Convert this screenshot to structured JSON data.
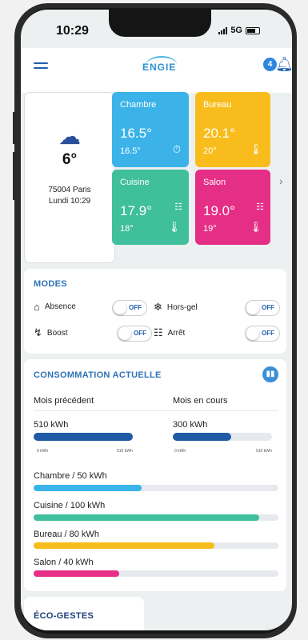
{
  "status_bar": {
    "time": "10:29",
    "network": "5G"
  },
  "header": {
    "logo": "ENGIE",
    "notification_count": "4"
  },
  "weather": {
    "temperature": "6°",
    "location": "75004 Paris",
    "datetime": "Lundi 10:29"
  },
  "rooms": [
    {
      "name": "Chambre",
      "current": "16.5°",
      "setpoint": "16.5°",
      "color": "#3bb3e8",
      "icon": "timer-icon"
    },
    {
      "name": "Bureau",
      "current": "20.1°",
      "setpoint": "20°",
      "color": "#f8bd1c",
      "icon": "thermometer-icon"
    },
    {
      "name": "Cuisine",
      "current": "17.9°",
      "setpoint": "18°",
      "color": "#3fbf9c",
      "icon": "thermometer-icon"
    },
    {
      "name": "Salon",
      "current": "19.0°",
      "setpoint": "19°",
      "color": "#e52e86",
      "icon": "thermometer-icon"
    }
  ],
  "modes": {
    "title": "MODES",
    "items": [
      {
        "label": "Absence",
        "state": "OFF",
        "icon": "home-away-icon"
      },
      {
        "label": "Hors-gel",
        "state": "OFF",
        "icon": "snowflake-icon"
      },
      {
        "label": "Boost",
        "state": "OFF",
        "icon": "lightning-icon"
      },
      {
        "label": "Arrêt",
        "state": "OFF",
        "icon": "radiator-icon"
      }
    ]
  },
  "consumption": {
    "title": "CONSOMMATION ACTUELLE",
    "previous": {
      "label": "Mois précédent",
      "value": "510 kWh",
      "min": "0 kWh",
      "max": "510 kWh",
      "fraction": 1.0
    },
    "current": {
      "label": "Mois en cours",
      "value": "300 kWh",
      "min": "0 kWh",
      "max": "510 kWh",
      "fraction": 0.59
    },
    "rooms": [
      {
        "label": "Chambre  / 50 kWh",
        "fraction": 0.44,
        "color": "#3bb3e8"
      },
      {
        "label": "Cuisine  / 100 kWh",
        "fraction": 0.92,
        "color": "#3fbf9c"
      },
      {
        "label": "Bureau  / 80 kWh",
        "fraction": 0.74,
        "color": "#f8bd1c"
      },
      {
        "label": "Salon  / 40 kWh",
        "fraction": 0.35,
        "color": "#e52e86"
      }
    ],
    "bar_color": "#1f5aa6"
  },
  "eco": {
    "title": "ÉCO-GESTES"
  }
}
